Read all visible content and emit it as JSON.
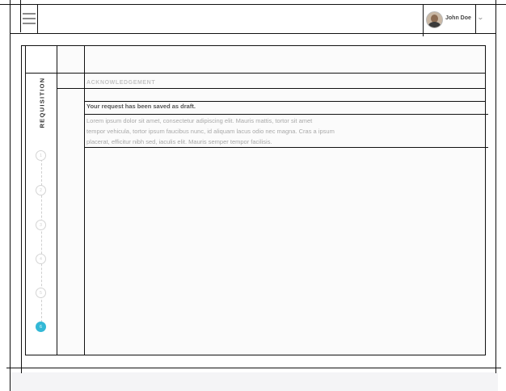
{
  "header": {
    "menu_icon": "hamburger-menu-icon",
    "user": {
      "name": "John Doe",
      "avatar_icon": "user-avatar"
    },
    "dropdown_icon": "chevron-down-icon"
  },
  "wizard": {
    "title": "REQUISITION",
    "steps": [
      "1",
      "2",
      "3",
      "4",
      "5",
      "6"
    ],
    "active_step": "6",
    "accent_color": "#33b8d6"
  },
  "content": {
    "section_label": "ACKNOWLEDGEMENT",
    "message": "Your request has been saved as draft.",
    "body_lines": [
      "Lorem ipsum dolor sit amet, consectetur adipiscing elit. Mauris mattis, tortor sit amet",
      "tempor vehicula, tortor ipsum faucibus nunc, id aliquam lacus odio nec magna. Cras a ipsum",
      "placerat, efficitur nibh sed, iaculis elit. Mauris semper tempor facilisis."
    ]
  }
}
